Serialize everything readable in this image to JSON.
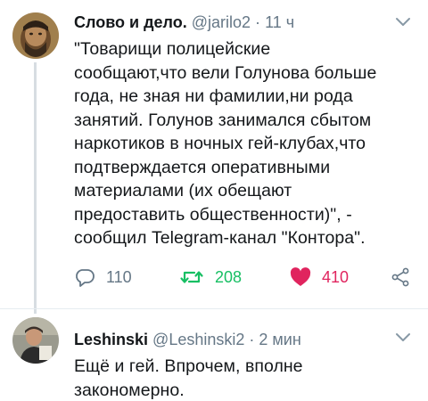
{
  "tweets": [
    {
      "author_name": "Слово и дело.",
      "handle": "@jarilo2",
      "separator": "·",
      "time": "11 ч",
      "text": "\"Товарищи полицейские\nсообщают,что вели Голунова больше\nгода, не зная  ни фамилии,ни рода\nзанятий. Голунов занимался сбытом\nнаркотиков в  ночных гей-клубах,что\nподтверждается оперативными\nматериалами (их  обещают\nпредоставить общественности)\", -\nсообщил Telegram-канал  \"Контора\".",
      "replies": "110",
      "retweets": "208",
      "likes": "410",
      "retweeted": true,
      "liked": true
    },
    {
      "author_name": "Leshinski",
      "handle": "@Leshinski2",
      "separator": "·",
      "time": "2 мин",
      "text": "Ещё и гей. Впрочем, вполне\nзакономерно."
    }
  ],
  "colors": {
    "text": "#14171a",
    "secondary": "#657786",
    "retweet": "#17bf63",
    "like": "#e0245e",
    "thread_line": "#d7dde2"
  }
}
